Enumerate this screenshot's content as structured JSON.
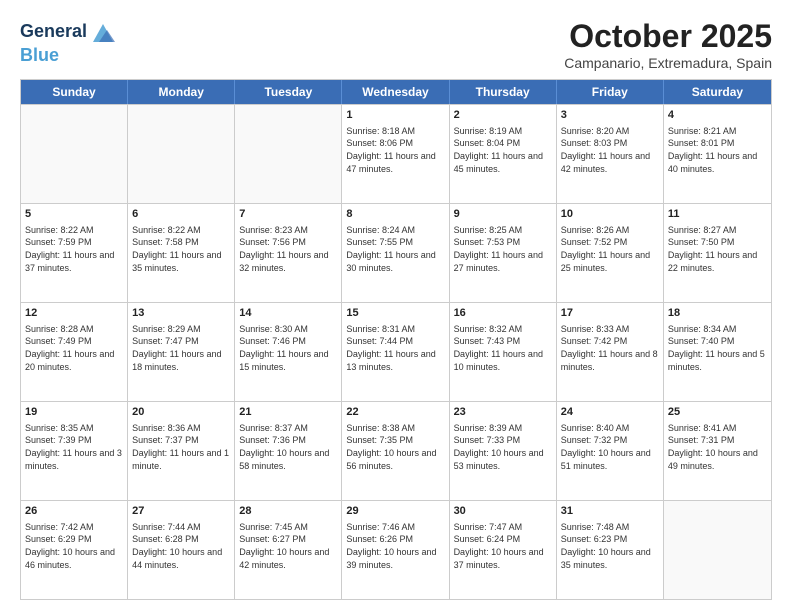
{
  "logo": {
    "line1": "General",
    "line2": "Blue"
  },
  "title": "October 2025",
  "subtitle": "Campanario, Extremadura, Spain",
  "headers": [
    "Sunday",
    "Monday",
    "Tuesday",
    "Wednesday",
    "Thursday",
    "Friday",
    "Saturday"
  ],
  "weeks": [
    [
      {
        "day": "",
        "sunrise": "",
        "sunset": "",
        "daylight": ""
      },
      {
        "day": "",
        "sunrise": "",
        "sunset": "",
        "daylight": ""
      },
      {
        "day": "",
        "sunrise": "",
        "sunset": "",
        "daylight": ""
      },
      {
        "day": "1",
        "sunrise": "Sunrise: 8:18 AM",
        "sunset": "Sunset: 8:06 PM",
        "daylight": "Daylight: 11 hours and 47 minutes."
      },
      {
        "day": "2",
        "sunrise": "Sunrise: 8:19 AM",
        "sunset": "Sunset: 8:04 PM",
        "daylight": "Daylight: 11 hours and 45 minutes."
      },
      {
        "day": "3",
        "sunrise": "Sunrise: 8:20 AM",
        "sunset": "Sunset: 8:03 PM",
        "daylight": "Daylight: 11 hours and 42 minutes."
      },
      {
        "day": "4",
        "sunrise": "Sunrise: 8:21 AM",
        "sunset": "Sunset: 8:01 PM",
        "daylight": "Daylight: 11 hours and 40 minutes."
      }
    ],
    [
      {
        "day": "5",
        "sunrise": "Sunrise: 8:22 AM",
        "sunset": "Sunset: 7:59 PM",
        "daylight": "Daylight: 11 hours and 37 minutes."
      },
      {
        "day": "6",
        "sunrise": "Sunrise: 8:22 AM",
        "sunset": "Sunset: 7:58 PM",
        "daylight": "Daylight: 11 hours and 35 minutes."
      },
      {
        "day": "7",
        "sunrise": "Sunrise: 8:23 AM",
        "sunset": "Sunset: 7:56 PM",
        "daylight": "Daylight: 11 hours and 32 minutes."
      },
      {
        "day": "8",
        "sunrise": "Sunrise: 8:24 AM",
        "sunset": "Sunset: 7:55 PM",
        "daylight": "Daylight: 11 hours and 30 minutes."
      },
      {
        "day": "9",
        "sunrise": "Sunrise: 8:25 AM",
        "sunset": "Sunset: 7:53 PM",
        "daylight": "Daylight: 11 hours and 27 minutes."
      },
      {
        "day": "10",
        "sunrise": "Sunrise: 8:26 AM",
        "sunset": "Sunset: 7:52 PM",
        "daylight": "Daylight: 11 hours and 25 minutes."
      },
      {
        "day": "11",
        "sunrise": "Sunrise: 8:27 AM",
        "sunset": "Sunset: 7:50 PM",
        "daylight": "Daylight: 11 hours and 22 minutes."
      }
    ],
    [
      {
        "day": "12",
        "sunrise": "Sunrise: 8:28 AM",
        "sunset": "Sunset: 7:49 PM",
        "daylight": "Daylight: 11 hours and 20 minutes."
      },
      {
        "day": "13",
        "sunrise": "Sunrise: 8:29 AM",
        "sunset": "Sunset: 7:47 PM",
        "daylight": "Daylight: 11 hours and 18 minutes."
      },
      {
        "day": "14",
        "sunrise": "Sunrise: 8:30 AM",
        "sunset": "Sunset: 7:46 PM",
        "daylight": "Daylight: 11 hours and 15 minutes."
      },
      {
        "day": "15",
        "sunrise": "Sunrise: 8:31 AM",
        "sunset": "Sunset: 7:44 PM",
        "daylight": "Daylight: 11 hours and 13 minutes."
      },
      {
        "day": "16",
        "sunrise": "Sunrise: 8:32 AM",
        "sunset": "Sunset: 7:43 PM",
        "daylight": "Daylight: 11 hours and 10 minutes."
      },
      {
        "day": "17",
        "sunrise": "Sunrise: 8:33 AM",
        "sunset": "Sunset: 7:42 PM",
        "daylight": "Daylight: 11 hours and 8 minutes."
      },
      {
        "day": "18",
        "sunrise": "Sunrise: 8:34 AM",
        "sunset": "Sunset: 7:40 PM",
        "daylight": "Daylight: 11 hours and 5 minutes."
      }
    ],
    [
      {
        "day": "19",
        "sunrise": "Sunrise: 8:35 AM",
        "sunset": "Sunset: 7:39 PM",
        "daylight": "Daylight: 11 hours and 3 minutes."
      },
      {
        "day": "20",
        "sunrise": "Sunrise: 8:36 AM",
        "sunset": "Sunset: 7:37 PM",
        "daylight": "Daylight: 11 hours and 1 minute."
      },
      {
        "day": "21",
        "sunrise": "Sunrise: 8:37 AM",
        "sunset": "Sunset: 7:36 PM",
        "daylight": "Daylight: 10 hours and 58 minutes."
      },
      {
        "day": "22",
        "sunrise": "Sunrise: 8:38 AM",
        "sunset": "Sunset: 7:35 PM",
        "daylight": "Daylight: 10 hours and 56 minutes."
      },
      {
        "day": "23",
        "sunrise": "Sunrise: 8:39 AM",
        "sunset": "Sunset: 7:33 PM",
        "daylight": "Daylight: 10 hours and 53 minutes."
      },
      {
        "day": "24",
        "sunrise": "Sunrise: 8:40 AM",
        "sunset": "Sunset: 7:32 PM",
        "daylight": "Daylight: 10 hours and 51 minutes."
      },
      {
        "day": "25",
        "sunrise": "Sunrise: 8:41 AM",
        "sunset": "Sunset: 7:31 PM",
        "daylight": "Daylight: 10 hours and 49 minutes."
      }
    ],
    [
      {
        "day": "26",
        "sunrise": "Sunrise: 7:42 AM",
        "sunset": "Sunset: 6:29 PM",
        "daylight": "Daylight: 10 hours and 46 minutes."
      },
      {
        "day": "27",
        "sunrise": "Sunrise: 7:44 AM",
        "sunset": "Sunset: 6:28 PM",
        "daylight": "Daylight: 10 hours and 44 minutes."
      },
      {
        "day": "28",
        "sunrise": "Sunrise: 7:45 AM",
        "sunset": "Sunset: 6:27 PM",
        "daylight": "Daylight: 10 hours and 42 minutes."
      },
      {
        "day": "29",
        "sunrise": "Sunrise: 7:46 AM",
        "sunset": "Sunset: 6:26 PM",
        "daylight": "Daylight: 10 hours and 39 minutes."
      },
      {
        "day": "30",
        "sunrise": "Sunrise: 7:47 AM",
        "sunset": "Sunset: 6:24 PM",
        "daylight": "Daylight: 10 hours and 37 minutes."
      },
      {
        "day": "31",
        "sunrise": "Sunrise: 7:48 AM",
        "sunset": "Sunset: 6:23 PM",
        "daylight": "Daylight: 10 hours and 35 minutes."
      },
      {
        "day": "",
        "sunrise": "",
        "sunset": "",
        "daylight": ""
      }
    ]
  ]
}
